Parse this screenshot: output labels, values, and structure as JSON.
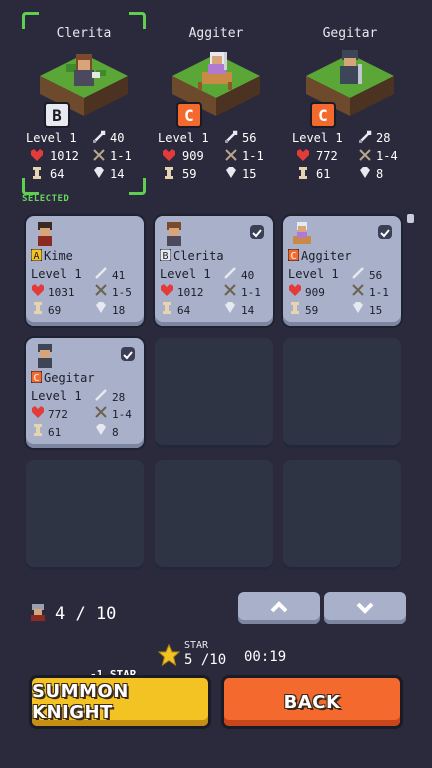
{
  "party": [
    {
      "name": "Clerita",
      "rank": "B",
      "level": "Level 1",
      "atk": "40",
      "hp": "1012",
      "range": "1-1",
      "speed": "64",
      "def": "14",
      "selected": true
    },
    {
      "name": "Aggiter",
      "rank": "C",
      "level": "Level 1",
      "atk": "56",
      "hp": "909",
      "range": "1-1",
      "speed": "59",
      "def": "15",
      "selected": false
    },
    {
      "name": "Gegitar",
      "rank": "C",
      "level": "Level 1",
      "atk": "28",
      "hp": "772",
      "range": "1-4",
      "speed": "61",
      "def": "8",
      "selected": false
    }
  ],
  "selected_label": "SELECTED",
  "roster": [
    {
      "name": "Kime",
      "rank": "A",
      "level": "Level 1",
      "atk": "41",
      "hp": "1031",
      "range": "1-5",
      "speed": "69",
      "def": "18",
      "checked": false
    },
    {
      "name": "Clerita",
      "rank": "B",
      "level": "Level 1",
      "atk": "40",
      "hp": "1012",
      "range": "1-1",
      "speed": "64",
      "def": "14",
      "checked": true
    },
    {
      "name": "Aggiter",
      "rank": "C",
      "level": "Level 1",
      "atk": "56",
      "hp": "909",
      "range": "1-1",
      "speed": "59",
      "def": "15",
      "checked": true
    },
    {
      "name": "Gegitar",
      "rank": "C",
      "level": "Level 1",
      "atk": "28",
      "hp": "772",
      "range": "1-4",
      "speed": "61",
      "def": "8",
      "checked": true
    }
  ],
  "knight_count": "4 / 10",
  "star_label": "STAR",
  "star_value": "5 /10",
  "timer": "00:19",
  "summon_cost": "-1 STAR",
  "summon_label": "SUMMON KNIGHT",
  "back_label": "BACK",
  "colors": {
    "summon": "#f3c223",
    "back": "#f46a2e",
    "card": "#a8b1c9",
    "bg": "#2a2a3c",
    "selected": "#5fcf4f"
  }
}
